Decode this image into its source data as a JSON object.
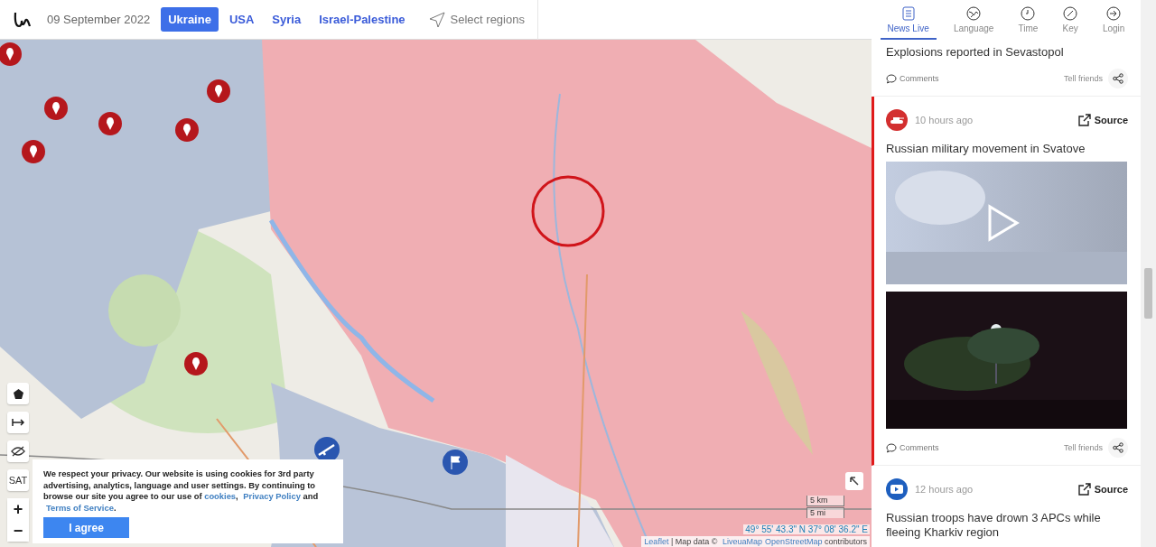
{
  "header": {
    "date": "09 September 2022",
    "regions": [
      {
        "label": "Ukraine",
        "selected": true
      },
      {
        "label": "USA",
        "selected": false
      },
      {
        "label": "Syria",
        "selected": false
      },
      {
        "label": "Israel-Palestine",
        "selected": false
      }
    ],
    "select_regions": "Select regions"
  },
  "nav_tabs": [
    {
      "label": "News Live",
      "kind": "news",
      "selected": true
    },
    {
      "label": "Language",
      "kind": "language",
      "selected": false
    },
    {
      "label": "Time",
      "kind": "time",
      "selected": false
    },
    {
      "label": "Key",
      "kind": "key",
      "selected": false
    },
    {
      "label": "Login",
      "kind": "login",
      "selected": false
    }
  ],
  "map": {
    "sat": "SAT",
    "zoom_in": "+",
    "zoom_out": "−",
    "scale": [
      "5 km",
      "5 mi"
    ],
    "coordinates": "49° 55' 43.3\" N 37° 08' 36.2\" E",
    "attribution": [
      {
        "kind": "link",
        "text": "Leaflet"
      },
      {
        "kind": "text",
        "text": " | Map data © "
      },
      {
        "kind": "link",
        "text": "LiveuaMap"
      },
      {
        "kind": "link",
        "text": "OpenStreetMap"
      },
      {
        "kind": "text",
        "text": " contributors"
      }
    ]
  },
  "cookie_notice": {
    "parts": [
      {
        "kind": "text",
        "text": "We respect your privacy. Our website is using cookies for 3rd party advertising, analytics, language and user settings. By continuing to browse our site you agree to our use of "
      },
      {
        "kind": "link",
        "text": "cookies"
      },
      {
        "kind": "text",
        "text": ", "
      },
      {
        "kind": "link",
        "text": "Privacy Policy"
      },
      {
        "kind": "text",
        "text": " and "
      },
      {
        "kind": "link",
        "text": "Terms of Service"
      },
      {
        "kind": "text",
        "text": "."
      }
    ],
    "button": "I agree"
  },
  "feed": [
    {
      "selected": false,
      "title": "Explosions reported in Sevastopol",
      "comments": "Comments",
      "share": "Tell friends"
    },
    {
      "selected": true,
      "kind": "tank",
      "color": "#d32f2f",
      "time": "10 hours ago",
      "source": "Source",
      "title": "Russian military movement in Svatove",
      "media": [
        {
          "kind": "video"
        },
        {
          "kind": "picture"
        }
      ],
      "comments": "Comments",
      "share": "Tell friends"
    },
    {
      "selected": false,
      "kind": "youtube",
      "color": "#1e5fbf",
      "time": "12 hours ago",
      "source": "Source",
      "title": "Russian troops have drown 3 APCs while fleeing Kharkiv region"
    }
  ]
}
